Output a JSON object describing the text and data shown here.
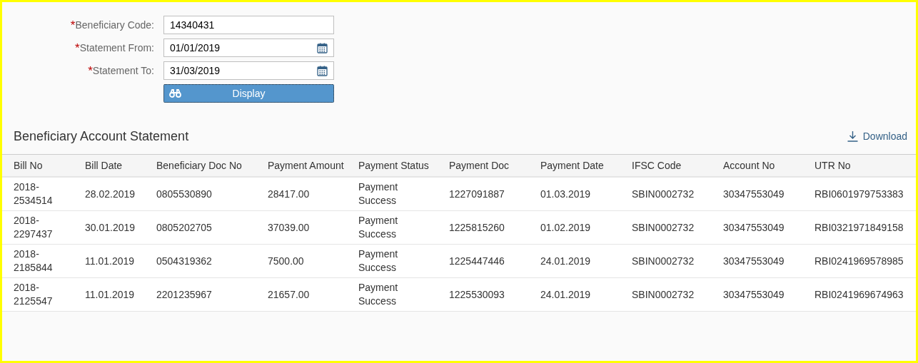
{
  "form": {
    "fields": [
      {
        "kind": "text",
        "label": "Beneficiary Code:",
        "required_mark": "*",
        "value": "14340431"
      },
      {
        "kind": "date",
        "label": "Statement From:",
        "required_mark": "*",
        "value": "01/01/2019"
      },
      {
        "kind": "date",
        "label": "Statement To:",
        "required_mark": "*",
        "value": "31/03/2019"
      }
    ],
    "button": "Display"
  },
  "section": {
    "title": "Beneficiary Account Statement",
    "download": "Download"
  },
  "table": {
    "columns": [
      "Bill No",
      "Bill Date",
      "Beneficiary Doc No",
      "Payment Amount",
      "Payment Status",
      "Payment Doc",
      "Payment Date",
      "IFSC Code",
      "Account No",
      "UTR No"
    ],
    "rows": [
      [
        "2018-2534514",
        "28.02.2019",
        "0805530890",
        "28417.00",
        "Payment Success",
        "1227091887",
        "01.03.2019",
        "SBIN0002732",
        "30347553049",
        "RBI0601979753383"
      ],
      [
        "2018-2297437",
        "30.01.2019",
        "0805202705",
        "37039.00",
        "Payment Success",
        "1225815260",
        "01.02.2019",
        "SBIN0002732",
        "30347553049",
        "RBI0321971849158"
      ],
      [
        "2018-2185844",
        "11.01.2019",
        "0504319362",
        "7500.00",
        "Payment Success",
        "1225447446",
        "24.01.2019",
        "SBIN0002732",
        "30347553049",
        "RBI0241969578985"
      ],
      [
        "2018-2125547",
        "11.01.2019",
        "2201235967",
        "21657.00",
        "Payment Success",
        "1225530093",
        "24.01.2019",
        "SBIN0002732",
        "30347553049",
        "RBI0241969674963"
      ]
    ]
  }
}
